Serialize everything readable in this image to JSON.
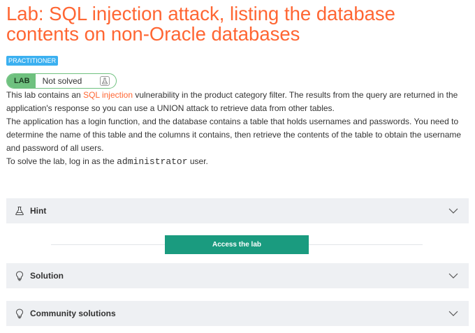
{
  "lab": {
    "title": "Lab: SQL injection attack, listing the database contents on non-Oracle databases",
    "level": "PRACTITIONER",
    "status": {
      "label": "LAB",
      "state": "Not solved",
      "icon": "flask-icon"
    },
    "description": {
      "p1_before": "This lab contains an ",
      "p1_link": "SQL injection",
      "p1_after": " vulnerability in the product category filter. The results from the query are returned in the application's response so you can use a UNION attack to retrieve data from other tables.",
      "p2": "The application has a login function, and the database contains a table that holds usernames and passwords. You need to determine the name of this table and the columns it contains, then retrieve the contents of the table to obtain the username and password of all users.",
      "p3_before": "To solve the lab, log in as the ",
      "p3_code": "administrator",
      "p3_after": " user."
    }
  },
  "sections": {
    "hint": {
      "label": "Hint",
      "icon": "flask-icon"
    },
    "access_button": "Access the lab",
    "solution": {
      "label": "Solution",
      "icon": "lightbulb-icon"
    },
    "community": {
      "label": "Community solutions",
      "icon": "lightbulb-icon"
    }
  },
  "colors": {
    "title": "#ff6633",
    "badge": "#3bb0f0",
    "status_green": "#6fc17f",
    "access_button": "#1a9b7f",
    "accordion_bg": "#eef0f3"
  }
}
